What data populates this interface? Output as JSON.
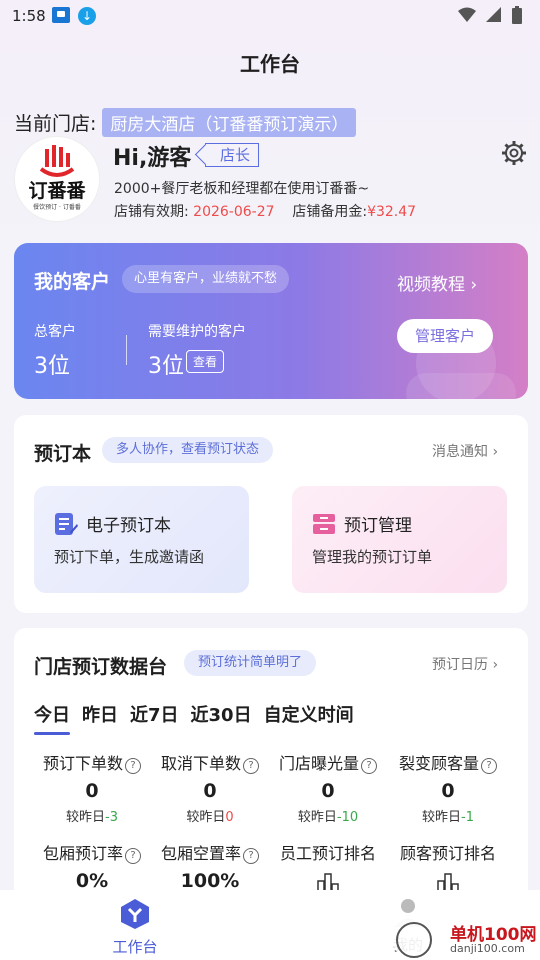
{
  "status_bar": {
    "time": "1:58"
  },
  "page_title": "工作台",
  "store": {
    "label": "当前门店:",
    "name": "厨房大酒店（订番番预订演示）"
  },
  "profile": {
    "logo_text": "订番番",
    "logo_sub": "餐饮预订 · 订番番",
    "greeting": "Hi,游客",
    "role": "店长",
    "intro": "2000+餐厅老板和经理都在使用订番番~",
    "valid_label": "店铺有效期:",
    "valid_date": "2026-06-27",
    "fund_label": "店铺备用金:",
    "fund_value": "¥32.47"
  },
  "customers": {
    "title": "我的客户",
    "slogan": "心里有客户，业绩就不愁",
    "video_link": "视频教程",
    "total_label": "总客户",
    "total_value": "3位",
    "maint_label": "需要维护的客户",
    "maint_value": "3位",
    "view_btn": "查看",
    "manage_btn": "管理客户"
  },
  "booking": {
    "title": "预订本",
    "pill": "多人协作，查看预订状态",
    "notify_link": "消息通知",
    "ebook_title": "电子预订本",
    "ebook_desc": "预订下单，生成邀请函",
    "manage_title": "预订管理",
    "manage_desc": "管理我的预订订单"
  },
  "stats": {
    "title": "门店预订数据台",
    "pill": "预订统计简单明了",
    "calendar_link": "预订日历",
    "tabs": [
      "今日",
      "昨日",
      "近7日",
      "近30日",
      "自定义时间"
    ],
    "metrics": [
      {
        "label": "预订下单数",
        "value": "0",
        "cmp_label": "较昨日",
        "cmp": "-3"
      },
      {
        "label": "取消下单数",
        "value": "0",
        "cmp_label": "较昨日",
        "cmp": "0"
      },
      {
        "label": "门店曝光量",
        "value": "0",
        "cmp_label": "较昨日",
        "cmp": "-10"
      },
      {
        "label": "裂变顾客量",
        "value": "0",
        "cmp_label": "较昨日",
        "cmp": "-1"
      }
    ],
    "metrics2": [
      {
        "label": "包厢预订率",
        "value": "0%"
      },
      {
        "label": "包厢空置率",
        "value": "100%"
      },
      {
        "label": "员工预订排名"
      },
      {
        "label": "顾客预订排名"
      }
    ]
  },
  "tabbar": {
    "home": "工作台",
    "me": "我的"
  },
  "watermark": {
    "name": "单机100网",
    "url": "danji100.com"
  },
  "colors": {
    "accent": "#4a5cd6",
    "red": "#ef4b4b",
    "green": "#3aa84a"
  }
}
